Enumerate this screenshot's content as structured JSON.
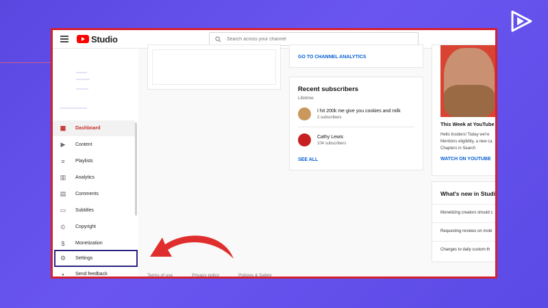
{
  "app": {
    "name": "Studio"
  },
  "search": {
    "placeholder": "Search across your channel"
  },
  "sidebar": {
    "items": [
      {
        "label": "Dashboard",
        "icon": "dashboard-icon",
        "active": true
      },
      {
        "label": "Content",
        "icon": "content-icon"
      },
      {
        "label": "Playlists",
        "icon": "playlists-icon"
      },
      {
        "label": "Analytics",
        "icon": "analytics-icon"
      },
      {
        "label": "Comments",
        "icon": "comments-icon"
      },
      {
        "label": "Subtitles",
        "icon": "subtitles-icon"
      },
      {
        "label": "Copyright",
        "icon": "copyright-icon"
      },
      {
        "label": "Monetization",
        "icon": "dollar-icon"
      },
      {
        "label": "Settings",
        "icon": "gear-icon"
      },
      {
        "label": "Send feedback",
        "icon": "feedback-icon"
      }
    ]
  },
  "analytics_card": {
    "link": "GO TO CHANNEL ANALYTICS"
  },
  "subscribers_card": {
    "title": "Recent subscribers",
    "period": "Lifetime",
    "rows": [
      {
        "name": "I hit 200k me give you cookies and milk",
        "count": "2 subscribers"
      },
      {
        "name": "Cathy Lewis",
        "count": "104 subscribers"
      }
    ],
    "see_all": "SEE ALL"
  },
  "news_card": {
    "title": "This Week at YouTube",
    "lines": [
      "Hello Insiders! Today we're",
      "Mentions eligibility, a new ca",
      "Chapters in Search"
    ],
    "link": "WATCH ON YOUTUBE"
  },
  "whats_new": {
    "title": "What's new in Studio",
    "items": [
      "Monetizing creators should c",
      "Requesting reviews on mobi",
      "Changes to daily custom th"
    ]
  },
  "footer": {
    "links": [
      "Terms of use",
      "Privacy policy",
      "Policies & Safety"
    ]
  },
  "colors": {
    "accent_red": "#d4202d",
    "link_blue": "#065fd4",
    "highlight_border": "#2b2384",
    "background": "#5a47e0"
  }
}
